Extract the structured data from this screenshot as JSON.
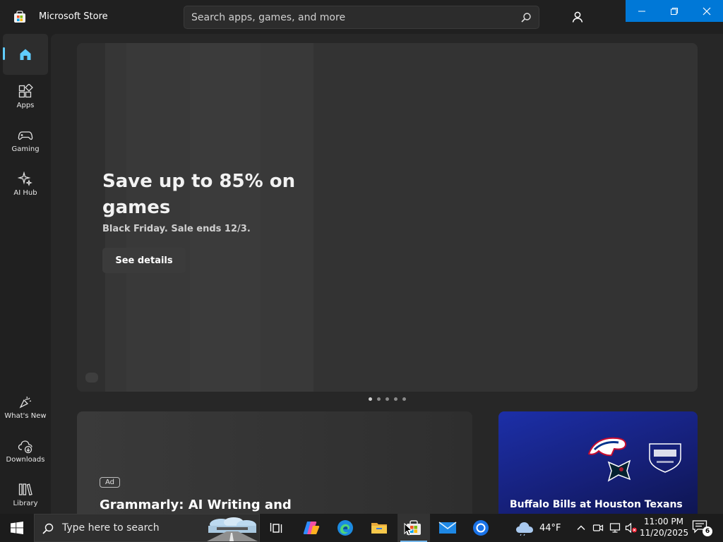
{
  "app": {
    "title": "Microsoft Store"
  },
  "search": {
    "placeholder": "Search apps, games, and more"
  },
  "sidebar": {
    "items": [
      {
        "label": "",
        "icon": "home-icon"
      },
      {
        "label": "Apps",
        "icon": "apps-icon"
      },
      {
        "label": "Gaming",
        "icon": "gamepad-icon"
      },
      {
        "label": "AI Hub",
        "icon": "ai-hub-icon"
      }
    ],
    "bottom_items": [
      {
        "label": "What's New",
        "icon": "whats-new-icon"
      },
      {
        "label": "Downloads",
        "icon": "downloads-icon"
      },
      {
        "label": "Library",
        "icon": "library-icon"
      }
    ]
  },
  "hero": {
    "title": "Save up to 85% on games",
    "subtitle": "Black Friday. Sale ends 12/3.",
    "button": "See details",
    "pager_count": 5,
    "pager_active": 0
  },
  "cards": {
    "ad": {
      "badge": "Ad",
      "title": "Grammarly: AI Writing and"
    },
    "game": {
      "title": "Buffalo Bills at Houston Texans"
    }
  },
  "taskbar": {
    "search_text": "Type here to search",
    "weather": "44°F",
    "time": "11:00 PM",
    "date": "11/20/2025",
    "notifications": "6"
  },
  "colors": {
    "accent": "#0078d7",
    "nav_indicator": "#60cdff",
    "background": "#202020"
  }
}
